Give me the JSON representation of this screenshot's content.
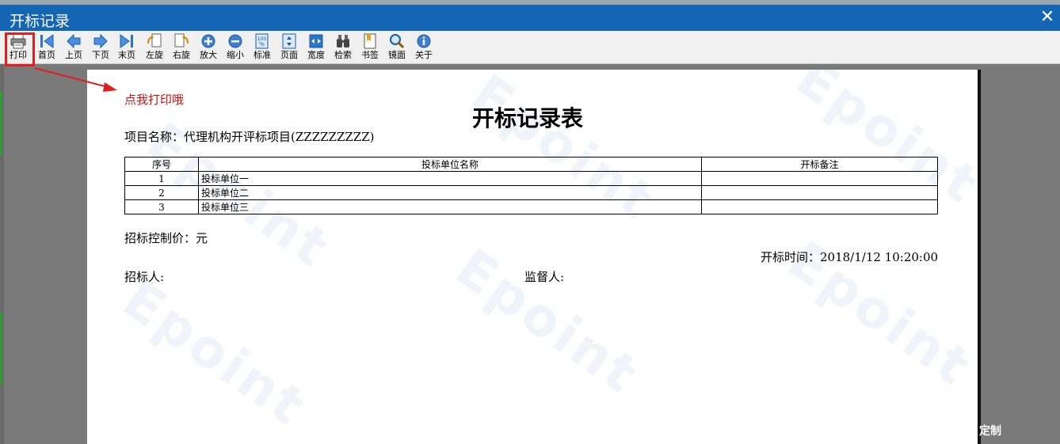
{
  "window": {
    "title": "开标记录",
    "close_glyph": "✕"
  },
  "toolbar": {
    "buttons": [
      {
        "label": "打印",
        "icon": "printer-icon"
      },
      {
        "label": "首页",
        "icon": "first-page-icon"
      },
      {
        "label": "上页",
        "icon": "prev-page-icon"
      },
      {
        "label": "下页",
        "icon": "next-page-icon"
      },
      {
        "label": "末页",
        "icon": "last-page-icon"
      },
      {
        "label": "左旋",
        "icon": "rotate-left-icon"
      },
      {
        "label": "右旋",
        "icon": "rotate-right-icon"
      },
      {
        "label": "放大",
        "icon": "zoom-in-icon"
      },
      {
        "label": "缩小",
        "icon": "zoom-out-icon"
      },
      {
        "label": "标准",
        "icon": "actual-size-icon"
      },
      {
        "label": "页面",
        "icon": "fit-page-icon"
      },
      {
        "label": "宽度",
        "icon": "fit-width-icon"
      },
      {
        "label": "检索",
        "icon": "binoculars-icon"
      },
      {
        "label": "书签",
        "icon": "bookmark-icon"
      },
      {
        "label": "镜面",
        "icon": "magnifier-icon"
      },
      {
        "label": "关于",
        "icon": "info-icon"
      }
    ]
  },
  "annotation": {
    "hint": "点我打印哦"
  },
  "document": {
    "title": "开标记录表",
    "project": "项目名称：代理机构开评标项目(ZZZZZZZZZ)",
    "table": {
      "headers": [
        "序号",
        "投标单位名称",
        "开标备注"
      ],
      "rows": [
        [
          "1",
          "投标单位一",
          ""
        ],
        [
          "2",
          "投标单位二",
          ""
        ],
        [
          "3",
          "投标单位三",
          ""
        ]
      ]
    },
    "control_price": "招标控制价：元",
    "open_time": "开标时间：2018/1/12 10:20:00",
    "tenderer": "招标人:",
    "supervisor": "监督人:"
  },
  "watermark": {
    "text": "Epoint"
  },
  "corner_text": "定制",
  "colors": {
    "titlebar": "#1565b5",
    "highlight": "#e02020",
    "hint": "#cc1111"
  }
}
